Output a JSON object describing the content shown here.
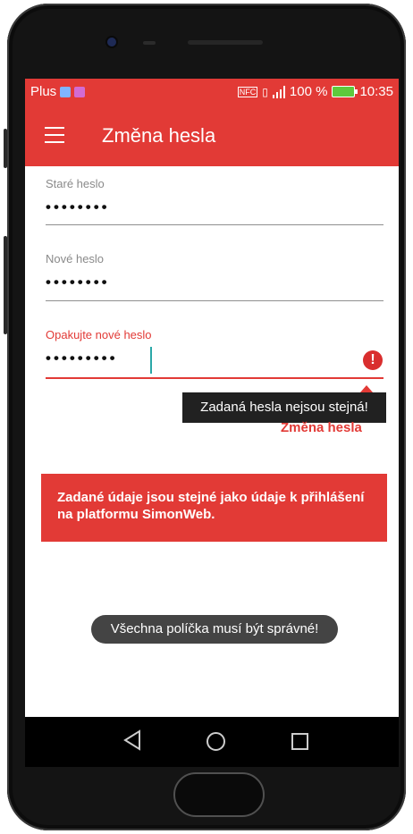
{
  "status_bar": {
    "carrier": "Plus",
    "battery_percent": "100 %",
    "time": "10:35",
    "indicators": [
      "nfc-icon",
      "vibrate-icon",
      "signal-icon",
      "battery-icon"
    ]
  },
  "app_bar": {
    "title": "Změna hesla",
    "menu_icon": "hamburger-icon"
  },
  "form": {
    "old_password": {
      "label": "Staré heslo",
      "value": "••••••••"
    },
    "new_password": {
      "label": "Nové heslo",
      "value": "••••••••"
    },
    "repeat_password": {
      "label": "Opakujte nové heslo",
      "value": "•••••••••"
    },
    "error_tooltip": "Zadaná hesla nejsou stejná!",
    "submit_label": "Změna hesla"
  },
  "info_box": {
    "text": "Zadané údaje jsou stejné jako údaje k přihlášení na platformu SimonWeb."
  },
  "toast": "Všechna políčka musí být správné!",
  "colors": {
    "accent": "#e23a36",
    "error": "#d92e2e",
    "caret": "#2aa8a8"
  }
}
